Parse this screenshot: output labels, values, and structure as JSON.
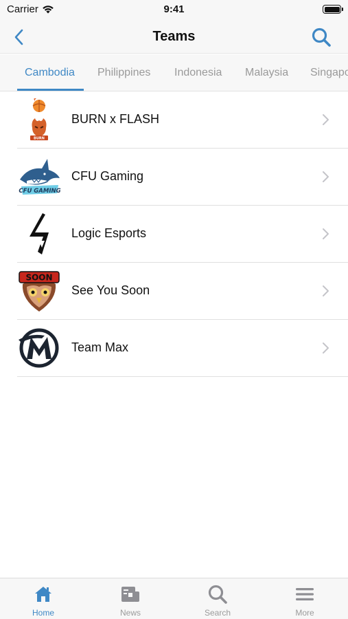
{
  "status_bar": {
    "carrier": "Carrier",
    "time": "9:41",
    "wifi_icon": "wifi-icon",
    "battery_icon": "battery-icon"
  },
  "nav": {
    "title": "Teams",
    "back_icon": "chevron-left-icon",
    "search_icon": "search-icon"
  },
  "tabs": [
    {
      "label": "Cambodia",
      "active": true
    },
    {
      "label": "Philippines",
      "active": false
    },
    {
      "label": "Indonesia",
      "active": false
    },
    {
      "label": "Malaysia",
      "active": false
    },
    {
      "label": "Singapore",
      "active": false
    }
  ],
  "teams": [
    {
      "name": "BURN x FLASH",
      "logo": "burn-x-flash-logo",
      "logo_text": "BURN"
    },
    {
      "name": "CFU Gaming",
      "logo": "cfu-gaming-logo",
      "logo_text": "CFU GAMING"
    },
    {
      "name": "Logic Esports",
      "logo": "logic-esports-logo"
    },
    {
      "name": "See You Soon",
      "logo": "see-you-soon-logo",
      "logo_text": "SOON"
    },
    {
      "name": "Team Max",
      "logo": "team-max-logo"
    }
  ],
  "tab_bar": [
    {
      "label": "Home",
      "icon": "home-icon",
      "active": true
    },
    {
      "label": "News",
      "icon": "news-icon",
      "active": false
    },
    {
      "label": "Search",
      "icon": "search-icon",
      "active": false
    },
    {
      "label": "More",
      "icon": "menu-icon",
      "active": false
    }
  ],
  "colors": {
    "accent": "#3f88c5",
    "inactive": "#9b9b9b",
    "bar_background": "#f7f7f7"
  }
}
